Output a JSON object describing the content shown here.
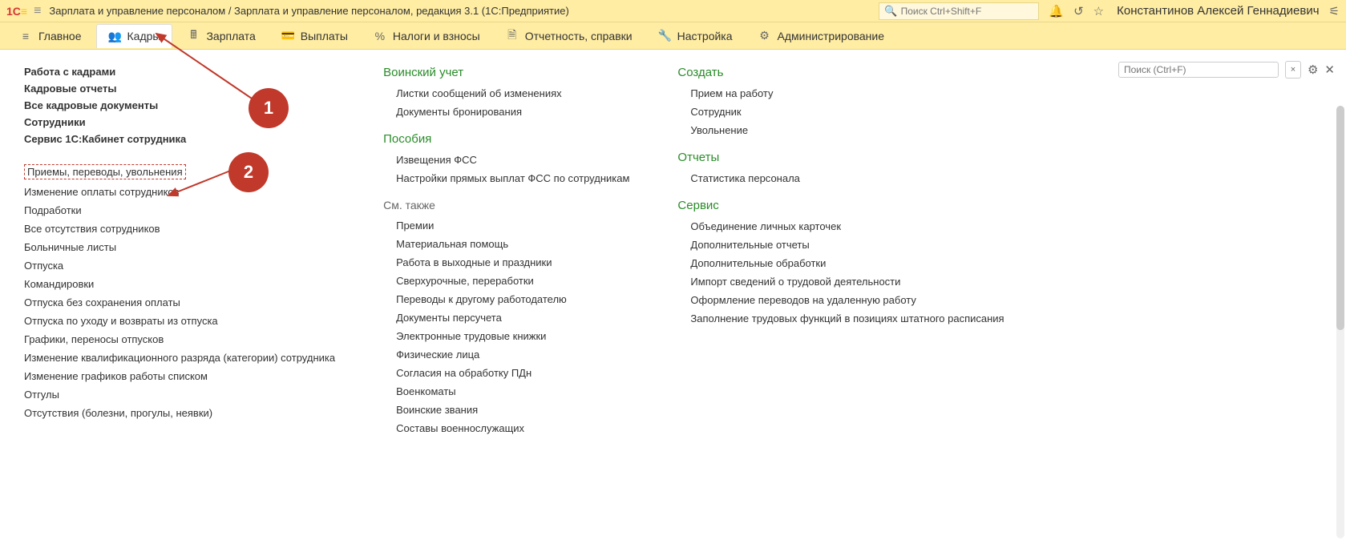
{
  "header": {
    "logo_text": "1С",
    "title": "Зарплата и управление персоналом / Зарплата и управление персоналом, редакция 3.1  (1С:Предприятие)",
    "search_placeholder": "Поиск Ctrl+Shift+F",
    "user_name": "Константинов Алексей Геннадиевич"
  },
  "toolbar": {
    "items": [
      {
        "label": "Главное"
      },
      {
        "label": "Кадры"
      },
      {
        "label": "Зарплата"
      },
      {
        "label": "Выплаты"
      },
      {
        "label": "Налоги и взносы"
      },
      {
        "label": "Отчетность, справки"
      },
      {
        "label": "Настройка"
      },
      {
        "label": "Администрирование"
      }
    ]
  },
  "content_search": {
    "placeholder": "Поиск (Ctrl+F)"
  },
  "annotations": {
    "badge1": "1",
    "badge2": "2"
  },
  "col1": {
    "heads": [
      "Работа с кадрами",
      "Кадровые отчеты",
      "Все кадровые документы",
      "Сотрудники",
      "Сервис 1С:Кабинет сотрудника"
    ],
    "links": [
      "Приемы, переводы, увольнения",
      "Изменение оплаты сотрудников",
      "Подработки",
      "Все отсутствия сотрудников",
      "Больничные листы",
      "Отпуска",
      "Командировки",
      "Отпуска без сохранения оплаты",
      "Отпуска по уходу и возвраты из отпуска",
      "Графики, переносы отпусков",
      "Изменение квалификационного разряда (категории) сотрудника",
      "Изменение графиков работы списком",
      "Отгулы",
      "Отсутствия (болезни, прогулы, неявки)"
    ]
  },
  "col2": {
    "sec1": {
      "title": "Воинский учет",
      "links": [
        "Листки сообщений об изменениях",
        "Документы бронирования"
      ]
    },
    "sec2": {
      "title": "Пособия",
      "links": [
        "Извещения ФСС",
        "Настройки прямых выплат ФСС по сотрудникам"
      ]
    },
    "see_also_label": "См. также",
    "see_also_links": [
      "Премии",
      "Материальная помощь",
      "Работа в выходные и праздники",
      "Сверхурочные, переработки",
      "Переводы к другому работодателю",
      "Документы персучета",
      "Электронные трудовые книжки",
      "Физические лица",
      "Согласия на обработку ПДн",
      "Военкоматы",
      "Воинские звания",
      "Составы военнослужащих"
    ]
  },
  "col3": {
    "sec1": {
      "title": "Создать",
      "links": [
        "Прием на работу",
        "Сотрудник",
        "Увольнение"
      ]
    },
    "sec2": {
      "title": "Отчеты",
      "links": [
        "Статистика персонала"
      ]
    },
    "sec3": {
      "title": "Сервис",
      "links": [
        "Объединение личных карточек",
        "Дополнительные отчеты",
        "Дополнительные обработки",
        "Импорт сведений о трудовой деятельности",
        "Оформление переводов на удаленную работу",
        "Заполнение трудовых функций в позициях штатного расписания"
      ]
    }
  }
}
